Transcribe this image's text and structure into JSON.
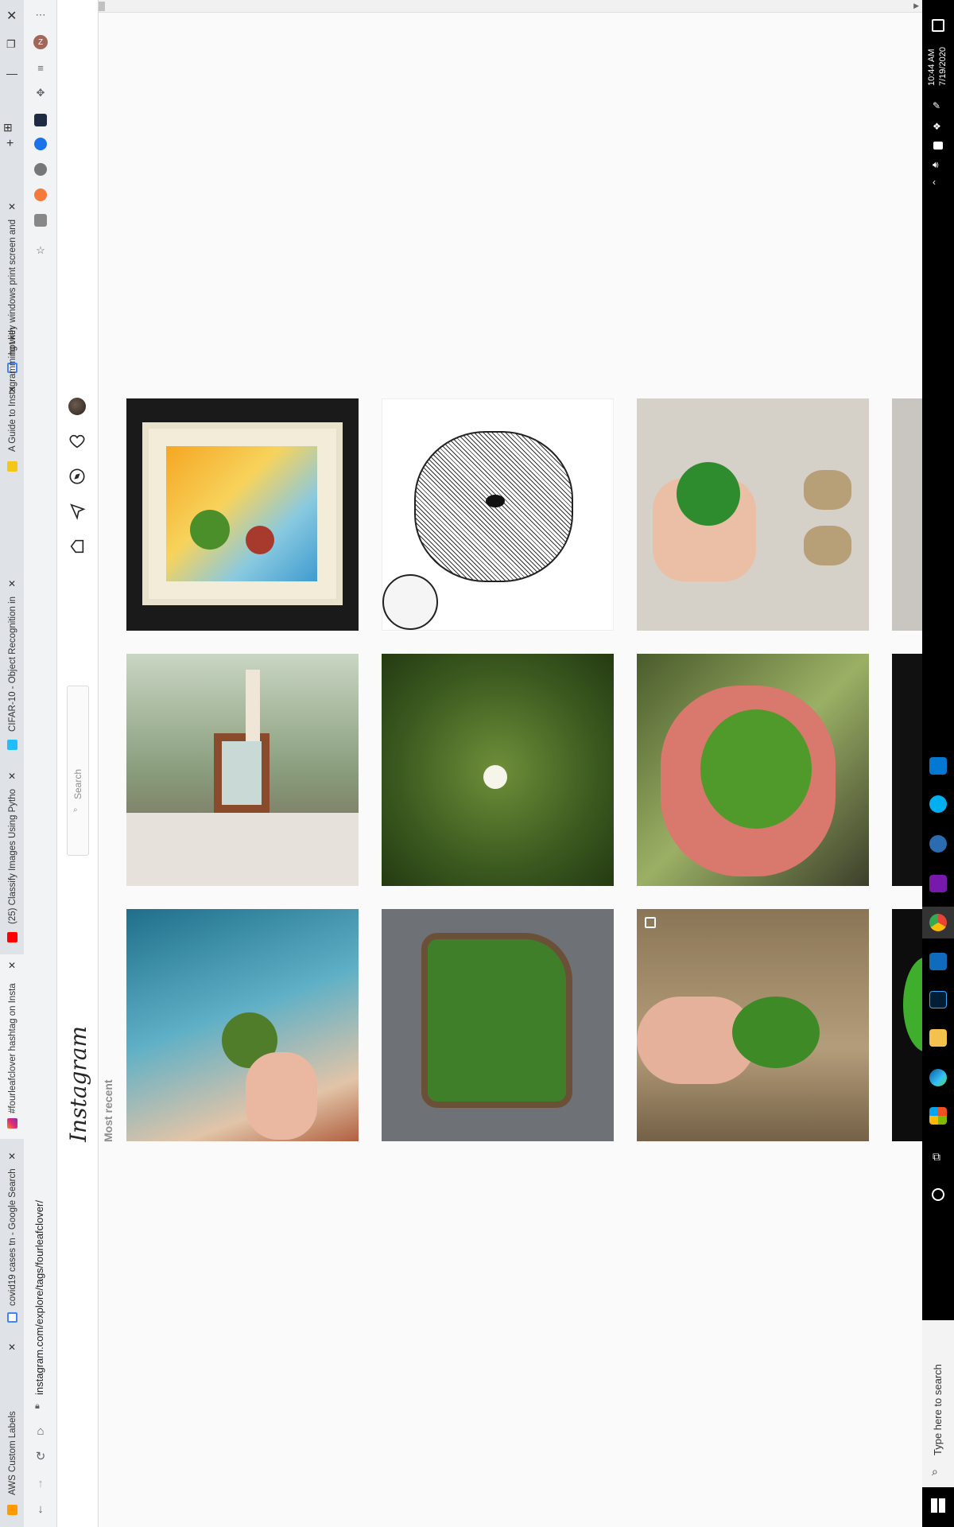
{
  "browser": {
    "tabs": [
      {
        "title": "AWS Custom Labels",
        "active": false
      },
      {
        "title": "instagram.com/explore/tags/fourleafclover/",
        "active": false,
        "is_url": true
      },
      {
        "title": "covid19 cases tn - Google Search",
        "active": false
      },
      {
        "title": "#fourleafclover hashtag on Insta",
        "active": true
      },
      {
        "title": "(25) Classify Images Using Pytho",
        "active": false
      },
      {
        "title": "CIFAR-10 - Object Recognition in",
        "active": false
      },
      {
        "title": "A Guide to Instagramming with",
        "active": false
      },
      {
        "title": "hot key windows print screen and",
        "active": false
      }
    ],
    "address_bar": "instagram.com/explore/tags/fourleafclover/",
    "profile_initial": "Z",
    "menu_label": "⋯"
  },
  "instagram": {
    "logo": "Instagram",
    "search_placeholder": "Search",
    "section_label": "Most recent"
  },
  "taskbar": {
    "search_placeholder": "Type here to search",
    "time": "10:44 AM",
    "date": "7/19/2020"
  },
  "colors": {
    "ig_border": "#dbdbdb",
    "taskbar_bg": "#000000",
    "tabstrip_bg": "#dfe3e8"
  }
}
